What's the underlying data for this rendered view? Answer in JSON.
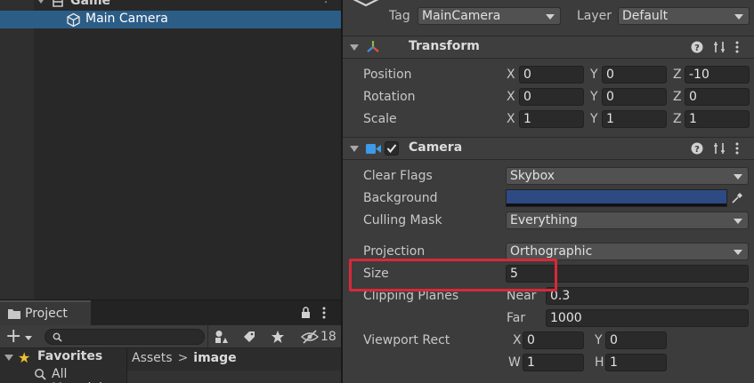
{
  "hierarchy": {
    "game_label": "Game",
    "camera_label": "Main Camera"
  },
  "project": {
    "tab_label": "Project",
    "search_placeholder": "",
    "hidden_count": "18",
    "favorites_label": "Favorites",
    "favorites_child": "All Materials",
    "breadcrumb_root": "Assets",
    "breadcrumb_sep": ">",
    "breadcrumb_current": "image"
  },
  "inspector": {
    "tag_label": "Tag",
    "tag_value": "MainCamera",
    "layer_label": "Layer",
    "layer_value": "Default",
    "transform": {
      "title": "Transform",
      "position_label": "Position",
      "rotation_label": "Rotation",
      "scale_label": "Scale",
      "x_label": "X",
      "y_label": "Y",
      "z_label": "Z",
      "position": {
        "x": "0",
        "y": "0",
        "z": "-10"
      },
      "rotation": {
        "x": "0",
        "y": "0",
        "z": "0"
      },
      "scale": {
        "x": "1",
        "y": "1",
        "z": "1"
      }
    },
    "camera": {
      "title": "Camera",
      "enabled": true,
      "clear_flags_label": "Clear Flags",
      "clear_flags_value": "Skybox",
      "background_label": "Background",
      "background_color": "#2e4a82",
      "culling_mask_label": "Culling Mask",
      "culling_mask_value": "Everything",
      "projection_label": "Projection",
      "projection_value": "Orthographic",
      "size_label": "Size",
      "size_value": "5",
      "clipping_label": "Clipping Planes",
      "near_label": "Near",
      "near_value": "0.3",
      "far_label": "Far",
      "far_value": "1000",
      "viewport_label": "Viewport Rect",
      "vx_label": "X",
      "vx_value": "0",
      "vy_label": "Y",
      "vy_value": "0",
      "vw_label": "W",
      "vw_value": "1",
      "vh_label": "H",
      "vh_value": "1"
    }
  },
  "colors": {
    "selection": "#2c5d87",
    "highlight_box": "#d8283a",
    "favorites_star": "#f0c030"
  }
}
